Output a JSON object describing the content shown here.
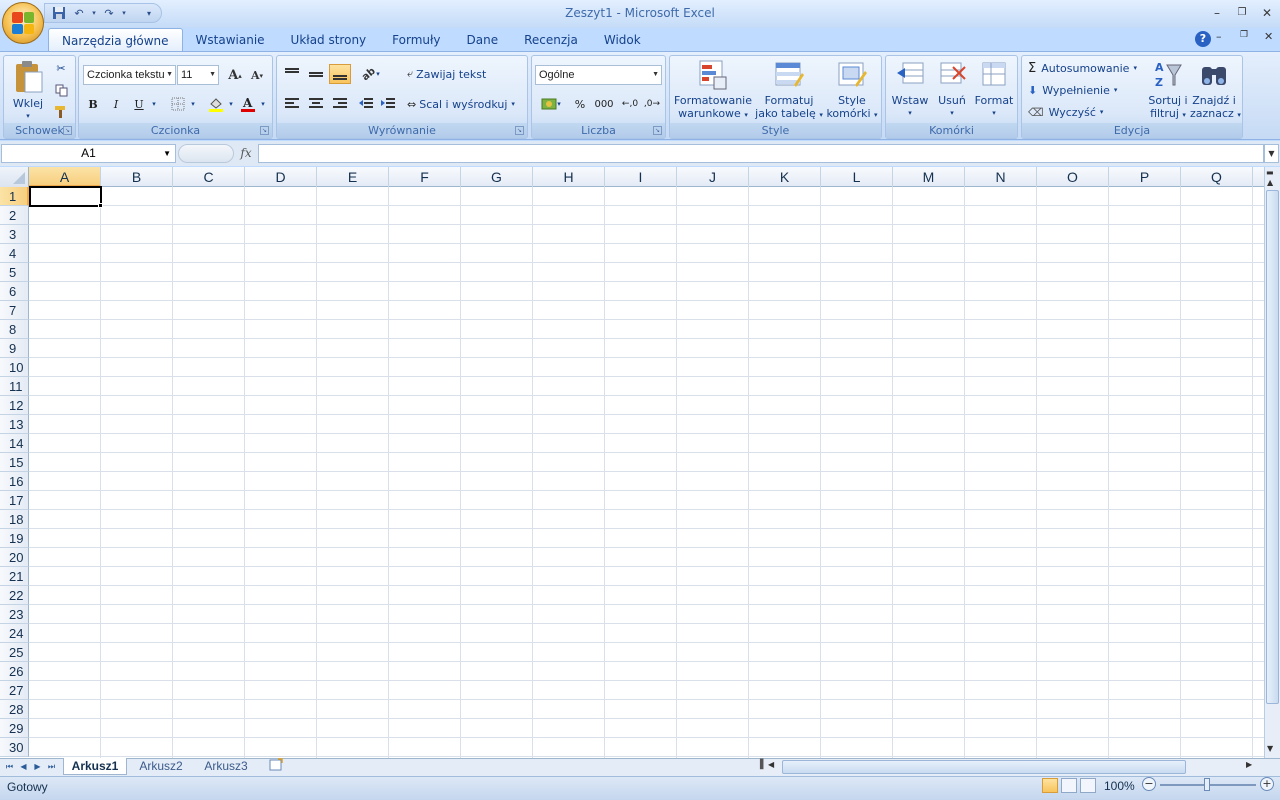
{
  "window": {
    "title": "Zeszyt1 - Microsoft Excel"
  },
  "tabs": [
    "Narzędzia główne",
    "Wstawianie",
    "Układ strony",
    "Formuły",
    "Dane",
    "Recenzja",
    "Widok"
  ],
  "ribbon": {
    "clipboard": {
      "label": "Schowek",
      "paste": "Wklej"
    },
    "font": {
      "label": "Czcionka",
      "font_name": "Czcionka tekstu",
      "font_size": "11",
      "bold": "B",
      "italic": "I",
      "underline": "U"
    },
    "alignment": {
      "label": "Wyrównanie",
      "wrap": "Zawijaj tekst",
      "merge": "Scal i wyśrodkuj"
    },
    "number": {
      "label": "Liczba",
      "format": "Ogólne",
      "percent": "%",
      "thousands": "000"
    },
    "styles": {
      "label": "Style",
      "conditional": [
        "Formatowanie",
        "warunkowe"
      ],
      "table": [
        "Formatuj",
        "jako tabelę"
      ],
      "cell": [
        "Style",
        "komórki"
      ]
    },
    "cells": {
      "label": "Komórki",
      "insert": "Wstaw",
      "delete": "Usuń",
      "format": "Format"
    },
    "editing": {
      "label": "Edycja",
      "autosum": "Autosumowanie",
      "fill": "Wypełnienie",
      "clear": "Wyczyść",
      "sort": [
        "Sortuj i",
        "filtruj"
      ],
      "find": [
        "Znajdź i",
        "zaznacz"
      ]
    }
  },
  "formula_bar": {
    "name_box": "A1",
    "fx": "fx",
    "value": ""
  },
  "grid": {
    "columns": [
      "A",
      "B",
      "C",
      "D",
      "E",
      "F",
      "G",
      "H",
      "I",
      "J",
      "K",
      "L",
      "M",
      "N",
      "O",
      "P",
      "Q"
    ],
    "rows": [
      "1",
      "2",
      "3",
      "4",
      "5",
      "6",
      "7",
      "8",
      "9",
      "10",
      "11",
      "12",
      "13",
      "14",
      "15",
      "16",
      "17",
      "18",
      "19",
      "20",
      "21",
      "22",
      "23",
      "24",
      "25",
      "26",
      "27",
      "28",
      "29",
      "30"
    ],
    "selected_cell": "A1"
  },
  "sheets": [
    "Arkusz1",
    "Arkusz2",
    "Arkusz3"
  ],
  "active_sheet": "Arkusz1",
  "status": {
    "text": "Gotowy",
    "zoom": "100%"
  }
}
